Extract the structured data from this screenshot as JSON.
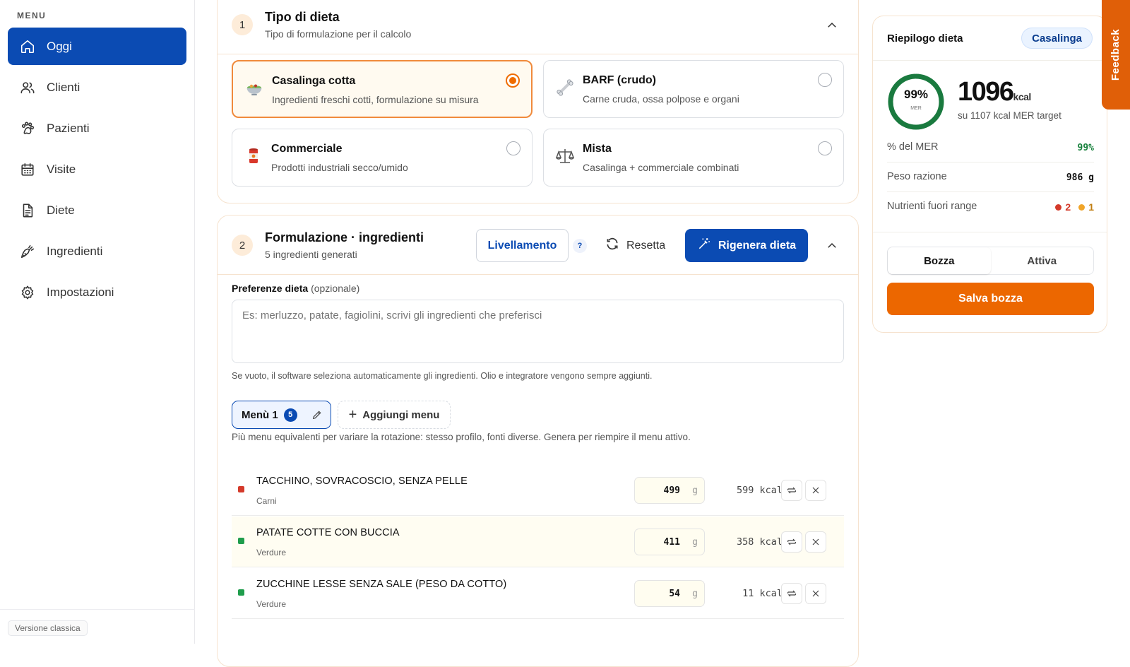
{
  "sidebar": {
    "menu_label": "MENU",
    "items": [
      {
        "label": "Oggi",
        "icon": "home-icon",
        "active": true
      },
      {
        "label": "Clienti",
        "icon": "users-icon"
      },
      {
        "label": "Pazienti",
        "icon": "paw-icon"
      },
      {
        "label": "Visite",
        "icon": "calendar-icon"
      },
      {
        "label": "Diete",
        "icon": "document-icon"
      },
      {
        "label": "Ingredienti",
        "icon": "carrot-icon"
      },
      {
        "label": "Impostazioni",
        "icon": "gear-icon"
      }
    ],
    "classic_version": "Versione classica"
  },
  "diet_type": {
    "step": "1",
    "title": "Tipo di dieta",
    "subtitle": "Tipo di formulazione per il calcolo",
    "options": [
      {
        "title": "Casalinga cotta",
        "subtitle": "Ingredienti freschi cotti, formulazione su misura",
        "icon": "bowl-icon",
        "selected": true
      },
      {
        "title": "BARF (crudo)",
        "subtitle": "Carne cruda, ossa polpose e organi",
        "icon": "bone-icon",
        "selected": false
      },
      {
        "title": "Commerciale",
        "subtitle": "Prodotti industriali secco/umido",
        "icon": "can-icon",
        "selected": false
      },
      {
        "title": "Mista",
        "subtitle": "Casalinga + commerciale combinati",
        "icon": "scale-icon",
        "selected": false
      }
    ]
  },
  "formulation": {
    "step": "2",
    "title": "Formulazione · ingredienti",
    "subtitle": "5 ingredienti generati",
    "leveling_label": "Livellamento",
    "help": "?",
    "reset_label": "Resetta",
    "regen_label": "Rigenera dieta",
    "pref_label": "Preferenze dieta",
    "pref_optional": "(opzionale)",
    "pref_placeholder": "Es: merluzzo, patate, fagiolini, scrivi gli ingredienti che preferisci",
    "pref_hint": "Se vuoto, il software seleziona automaticamente gli ingredienti. Olio e integratore vengono sempre aggiunti.",
    "menu_label": "Menù 1",
    "menu_count": "5",
    "add_menu_label": "Aggiungi menu",
    "menu_hint": "Più menu equivalenti per variare la rotazione: stesso profilo, fonti diverse. Genera per riempire il menu attivo.",
    "ingredients": [
      {
        "name": "TACCHINO, SOVRACOSCIO, SENZA PELLE",
        "category": "Carni",
        "grams": "499",
        "unit": "g",
        "kcal": "599 kcal",
        "status_color": "#d43a2a"
      },
      {
        "name": "PATATE COTTE CON BUCCIA",
        "category": "Verdure",
        "grams": "411",
        "unit": "g",
        "kcal": "358 kcal",
        "status_color": "#1f9d4c"
      },
      {
        "name": "ZUCCHINE LESSE SENZA SALE (PESO DA COTTO)",
        "category": "Verdure",
        "grams": "54",
        "unit": "g",
        "kcal": "11 kcal",
        "status_color": "#1f9d4c"
      }
    ]
  },
  "summary": {
    "title": "Riepilogo dieta",
    "badge": "Casalinga",
    "ring_percent": "99%",
    "ring_label": "MER",
    "ring_fraction": 0.99,
    "kcal_value": "1096",
    "kcal_unit": "kcal",
    "kcal_target": "su 1107 kcal MER target",
    "stats": {
      "mer_label": "% del MER",
      "mer_value": "99%",
      "weight_label": "Peso razione",
      "weight_value": "986 g",
      "out_label": "Nutrienti fuori range",
      "out_red": "2",
      "out_orange": "1"
    },
    "seg_draft": "Bozza",
    "seg_active": "Attiva",
    "save_label": "Salva bozza"
  },
  "feedback_label": "Feedback",
  "colors": {
    "primary": "#0b4bb3",
    "accent": "#ec6700",
    "ring": "#1a7a3f"
  }
}
